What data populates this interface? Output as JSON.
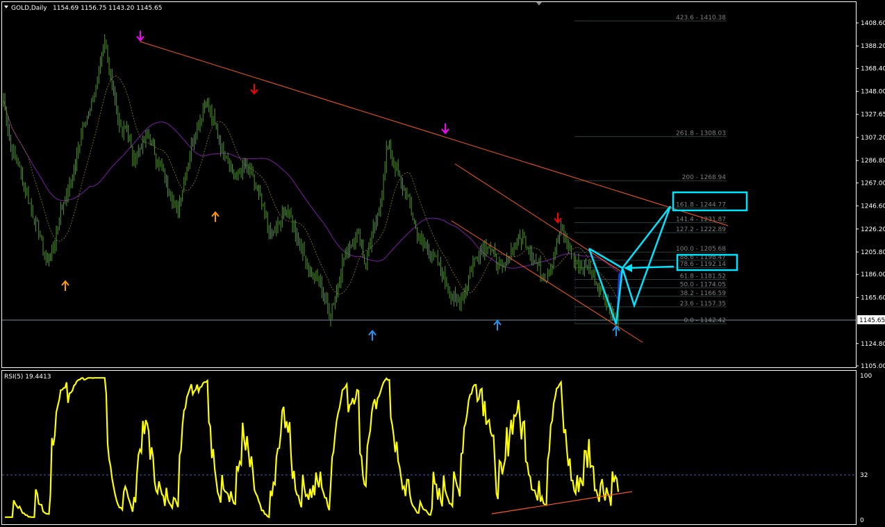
{
  "header": {
    "symbol": "GOLD,Daily",
    "ohlc": "1154.69 1156.75 1143.20 1145.65"
  },
  "rsi_header": "RSI(5) 19.4413",
  "colors": {
    "background": "#000000",
    "frame": "#ffffff",
    "bars": "#4e9a2e",
    "sma_slow": "#6a1b8f",
    "sma_fast_dotted": "#7a6a2a",
    "trendline": "#ff5a1f",
    "pattern": "#00e5ff",
    "rsi": "#ffff00",
    "rsi_level": "#3b5ec4",
    "fib": "#2e3f3f",
    "price_line": "#6f8fa0"
  },
  "chart_data": [
    {
      "type": "candlestick",
      "title": "GOLD,Daily",
      "ylim": [
        1105.0,
        1418.0
      ],
      "y_ticks": [
        "1408.60",
        "1388.20",
        "1368.40",
        "1348.00",
        "1327.65",
        "1307.20",
        "1286.80",
        "1267.00",
        "1246.60",
        "1226.20",
        "1205.80",
        "1186.00",
        "1165.60",
        "1145.65",
        "1124.80",
        "1105.00"
      ],
      "current_price": "1145.65",
      "close_path": [
        1340,
        1300,
        1285,
        1262,
        1240,
        1222,
        1195,
        1212,
        1245,
        1260,
        1285,
        1320,
        1330,
        1360,
        1395,
        1352,
        1315,
        1318,
        1285,
        1300,
        1310,
        1292,
        1275,
        1260,
        1242,
        1270,
        1300,
        1320,
        1340,
        1322,
        1300,
        1290,
        1270,
        1282,
        1278,
        1262,
        1240,
        1220,
        1228,
        1245,
        1232,
        1212,
        1196,
        1182,
        1175,
        1150,
        1170,
        1200,
        1212,
        1225,
        1195,
        1222,
        1240,
        1300,
        1285,
        1265,
        1252,
        1226,
        1212,
        1205,
        1196,
        1182,
        1165,
        1160,
        1176,
        1198,
        1208,
        1214,
        1200,
        1190,
        1204,
        1216,
        1218,
        1204,
        1192,
        1182,
        1200,
        1226,
        1214,
        1196,
        1190,
        1194,
        1178,
        1168,
        1154,
        1146
      ],
      "fibonacci_levels": [
        {
          "label": "423.6 - 1410.38",
          "value": 1410.38
        },
        {
          "label": "261.8 - 1308.03",
          "value": 1308.03
        },
        {
          "label": "200 - 1268.94",
          "value": 1268.94
        },
        {
          "label": "161.8 - 1244.77",
          "value": 1244.77
        },
        {
          "label": "141.4 - 1231.87",
          "value": 1231.87
        },
        {
          "label": "127.2 - 1222.89",
          "value": 1222.89
        },
        {
          "label": "100.0 - 1205.68",
          "value": 1205.68
        },
        {
          "label": "88.6 - 1198.47",
          "value": 1198.47
        },
        {
          "label": "78.6 - 1192.14",
          "value": 1192.14
        },
        {
          "label": "61.8 - 1181.52",
          "value": 1181.52
        },
        {
          "label": "50.0 - 1174.05",
          "value": 1174.05
        },
        {
          "label": "38.2 - 1166.59",
          "value": 1166.59
        },
        {
          "label": "23.6 - 1157.35",
          "value": 1157.35
        },
        {
          "label": "0.0 - 1142.42",
          "value": 1142.42
        }
      ],
      "arrows": [
        {
          "dir": "down",
          "color": "#ff00ff",
          "price": 1393
        },
        {
          "dir": "up",
          "color": "#ff9900",
          "price": 1180
        },
        {
          "dir": "up",
          "color": "#ff9900",
          "price": 1241
        },
        {
          "dir": "down",
          "color": "#ff0000",
          "price": 1346
        },
        {
          "dir": "up",
          "color": "#2196f3",
          "price": 1136
        },
        {
          "dir": "down",
          "color": "#ff00ff",
          "price": 1311
        },
        {
          "dir": "up",
          "color": "#2196f3",
          "price": 1145
        },
        {
          "dir": "down",
          "color": "#ff0000",
          "price": 1232
        },
        {
          "dir": "up",
          "color": "#2196f3",
          "price": 1140
        }
      ]
    },
    {
      "type": "line",
      "title": "RSI(5) 19.4413",
      "ylim": [
        0,
        100
      ],
      "y_ticks": [
        "100",
        "32",
        "0"
      ],
      "level": 32,
      "last_value": 19.4413
    }
  ]
}
